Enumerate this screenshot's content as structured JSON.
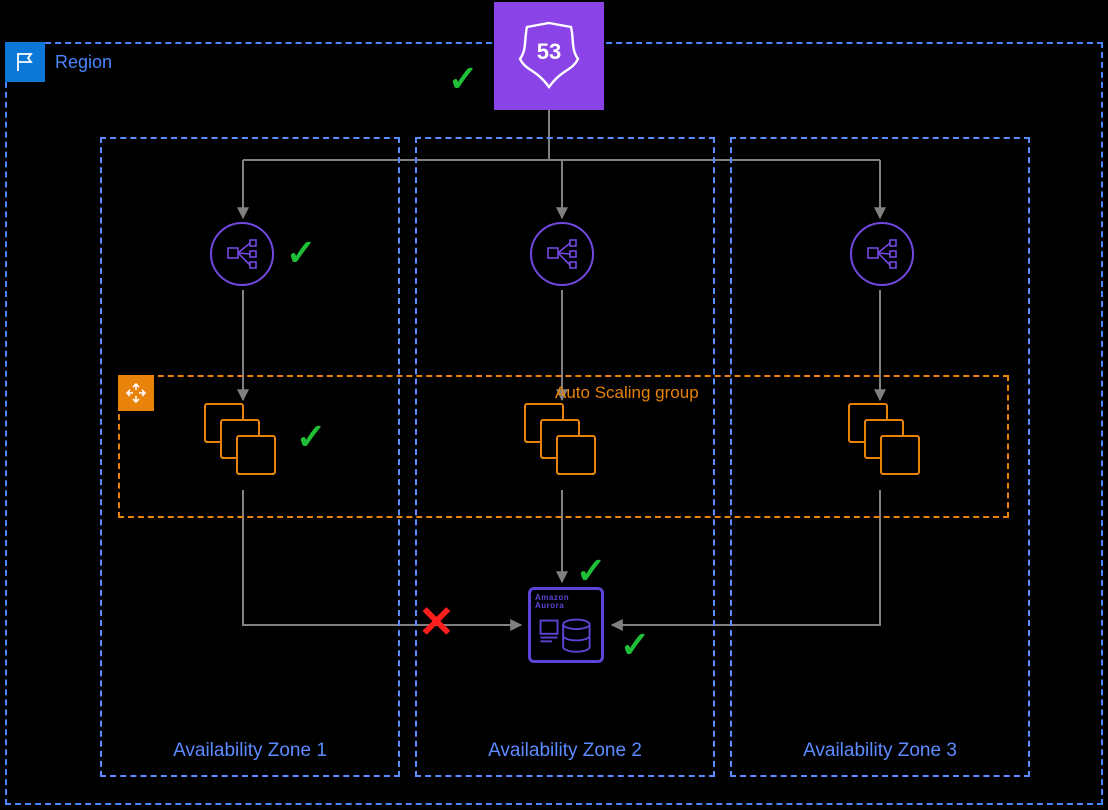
{
  "region": {
    "label": "Region"
  },
  "route53": {
    "name": "route53",
    "number": "53"
  },
  "az": {
    "labels": [
      "Availability Zone 1",
      "Availability Zone 2",
      "Availability Zone 3"
    ]
  },
  "asg": {
    "label": "Auto Scaling group"
  },
  "aurora": {
    "line1": "Amazon",
    "line2": "Aurora"
  },
  "marks": {
    "route53_check": "✓",
    "elb1_check": "✓",
    "stack1_check": "✓",
    "az1_cross": "✕",
    "aurora_top_check": "✓",
    "aurora_right_check": "✓"
  }
}
